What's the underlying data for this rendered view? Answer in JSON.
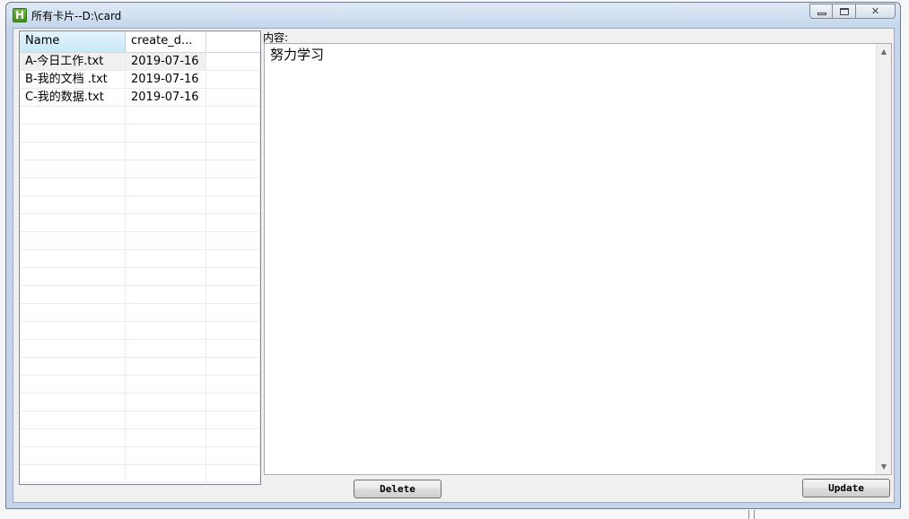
{
  "window": {
    "title": "所有卡片--D:\\card",
    "icon_letter": "H",
    "close_glyph": "✕"
  },
  "list": {
    "columns": [
      "Name",
      "create_d..."
    ],
    "rows": [
      {
        "name": "A-今日工作.txt",
        "date": "2019-07-16"
      },
      {
        "name": "B-我的文档 .txt",
        "date": "2019-07-16"
      },
      {
        "name": "C-我的数据.txt",
        "date": "2019-07-16"
      }
    ],
    "empty_rows": 21
  },
  "content": {
    "label": "内容:",
    "text": "努力学习"
  },
  "buttons": {
    "delete": "Delete",
    "update": "Update"
  },
  "scroll": {
    "up_glyph": "▲",
    "down_glyph": "▼"
  }
}
